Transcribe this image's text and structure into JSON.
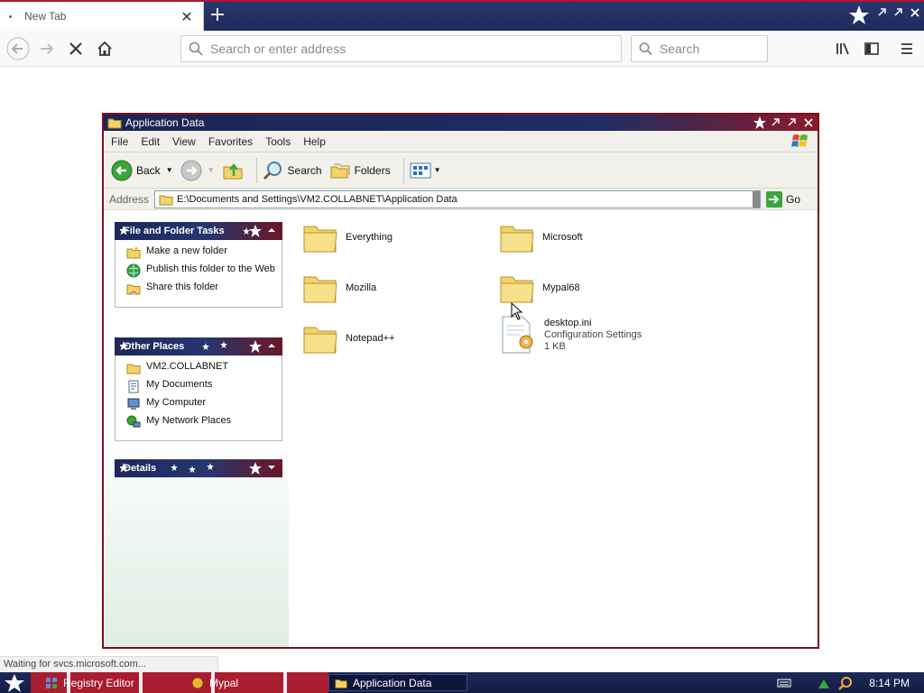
{
  "browser": {
    "tab_title": "New Tab",
    "url_placeholder": "Search or enter address",
    "search_placeholder": "Search",
    "status_text": "Waiting for svcs.microsoft.com..."
  },
  "window": {
    "title": "Application Data",
    "menu": [
      "File",
      "Edit",
      "View",
      "Favorites",
      "Tools",
      "Help"
    ],
    "toolbar": {
      "back": "Back",
      "search": "Search",
      "folders": "Folders"
    },
    "address_label": "Address",
    "address_value": "E:\\Documents and Settings\\VM2.COLLABNET\\Application Data",
    "go_label": "Go"
  },
  "panels": {
    "file_tasks": {
      "title": "File and Folder Tasks",
      "items": [
        "Make a new folder",
        "Publish this folder to the Web",
        "Share this folder"
      ]
    },
    "other_places": {
      "title": "Other Places",
      "items": [
        "VM2.COLLABNET",
        "My Documents",
        "My Computer",
        "My Network Places"
      ]
    },
    "details": {
      "title": "Details"
    }
  },
  "files": [
    {
      "name": "Everything",
      "type": "folder"
    },
    {
      "name": "Microsoft",
      "type": "folder"
    },
    {
      "name": "Mozilla",
      "type": "folder"
    },
    {
      "name": "Mypal68",
      "type": "folder"
    },
    {
      "name": "Notepad++",
      "type": "folder"
    },
    {
      "name": "desktop.ini",
      "type": "file",
      "kind": "Configuration Settings",
      "size": "1 KB"
    }
  ],
  "taskbar": {
    "tasks": [
      "Registry Editor",
      "Mypal",
      "Application Data"
    ],
    "clock": "8:14 PM"
  },
  "colors": {
    "navy": "#1e2a5a",
    "red": "#b2142a",
    "folder": "#f3d36b"
  }
}
